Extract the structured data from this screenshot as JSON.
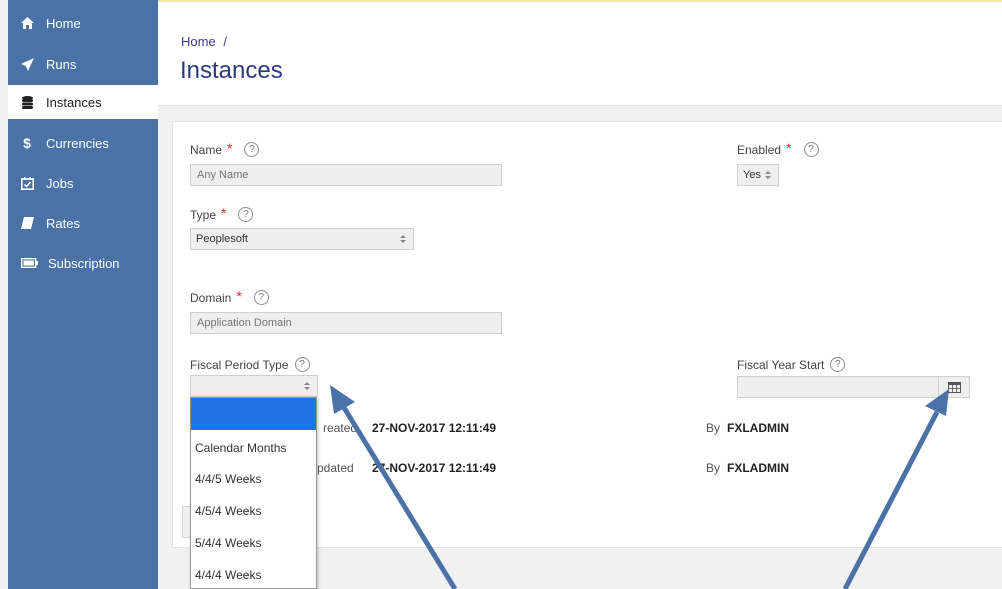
{
  "sidebar": {
    "items": [
      {
        "label": "Home",
        "icon": "home-icon"
      },
      {
        "label": "Runs",
        "icon": "rocket-icon"
      },
      {
        "label": "Instances",
        "icon": "database-icon"
      },
      {
        "label": "Currencies",
        "icon": "dollar-icon"
      },
      {
        "label": "Jobs",
        "icon": "calendar-check-icon"
      },
      {
        "label": "Rates",
        "icon": "book-icon"
      },
      {
        "label": "Subscription",
        "icon": "battery-icon"
      }
    ],
    "active": "Instances"
  },
  "header": {
    "breadcrumb": "Home",
    "breadcrumb_sep": "/",
    "title": "Instances"
  },
  "form": {
    "name": {
      "label": "Name",
      "placeholder": "Any Name",
      "value": ""
    },
    "enabled": {
      "label": "Enabled",
      "value": "Yes"
    },
    "type": {
      "label": "Type",
      "value": "Peoplesoft"
    },
    "domain": {
      "label": "Domain",
      "placeholder": "Application Domain",
      "value": ""
    },
    "fiscal_period_type": {
      "label": "Fiscal Period Type",
      "value": ""
    },
    "fiscal_year_start": {
      "label": "Fiscal Year Start",
      "value": ""
    },
    "help_glyph": "?",
    "required_glyph": "*"
  },
  "meta": {
    "created_label": "reated",
    "created_value": "27-NOV-2017 12:11:49",
    "created_by_label": "By",
    "created_by_value": "FXLADMIN",
    "updated_label": "pdated",
    "updated_value": "27-NOV-2017 12:11:49",
    "updated_by_label": "By",
    "updated_by_value": "FXLADMIN"
  },
  "dropdown": {
    "options": [
      "",
      "Calendar Months",
      "4/4/5 Weeks",
      "4/5/4 Weeks",
      "5/4/4 Weeks",
      "4/4/4 Weeks"
    ]
  },
  "colors": {
    "sidebar_bg": "#4a72a6",
    "accent_title": "#2c3a7c",
    "required": "#e02020",
    "dropdown_selected": "#1f73e6",
    "arrow": "#4a72a6"
  }
}
